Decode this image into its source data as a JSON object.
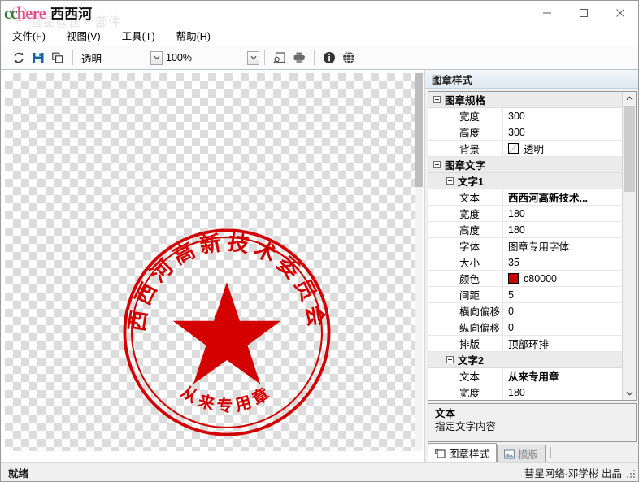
{
  "window": {
    "logo_cc": "cc",
    "logo_here": "here",
    "logo_cn": "西西河",
    "watermark": "彗星@国年部件",
    "minimize_label": "minimize",
    "maximize_label": "maximize",
    "close_label": "close"
  },
  "menubar": {
    "items": [
      {
        "label": "文件(F)"
      },
      {
        "label": "视图(V)"
      },
      {
        "label": "工具(T)"
      },
      {
        "label": "帮助(H)"
      }
    ]
  },
  "toolbar": {
    "refresh_label": "refresh",
    "save_label": "save",
    "copy_label": "copy",
    "background_combo": "透明",
    "zoom_combo": "100%",
    "preview_label": "preview",
    "print_label": "print",
    "info_label": "info",
    "web_label": "web"
  },
  "canvas": {
    "zoom": "100%",
    "background": "透明",
    "stamp": {
      "top_text": "西西河高新技术委员会",
      "bottom_text": "从来专用章",
      "color": "#d40000",
      "star": "★"
    }
  },
  "panel": {
    "header": "图章样式",
    "rows": [
      {
        "type": "cat",
        "indent": 0,
        "name": "图章规格",
        "value": "",
        "bold": false,
        "swatch": null
      },
      {
        "type": "prop",
        "indent": 2,
        "name": "宽度",
        "value": "300",
        "bold": false,
        "swatch": null
      },
      {
        "type": "prop",
        "indent": 2,
        "name": "高度",
        "value": "300",
        "bold": false,
        "swatch": null
      },
      {
        "type": "prop",
        "indent": 2,
        "name": "背景",
        "value": "透明",
        "bold": false,
        "swatch": "transparent"
      },
      {
        "type": "cat",
        "indent": 0,
        "name": "图章文字",
        "value": "",
        "bold": false,
        "swatch": null
      },
      {
        "type": "cat",
        "indent": 1,
        "name": "文字1",
        "value": "",
        "bold": false,
        "swatch": null
      },
      {
        "type": "prop",
        "indent": 2,
        "name": "文本",
        "value": "西西河高新技术...",
        "bold": true,
        "swatch": null
      },
      {
        "type": "prop",
        "indent": 2,
        "name": "宽度",
        "value": "180",
        "bold": false,
        "swatch": null
      },
      {
        "type": "prop",
        "indent": 2,
        "name": "高度",
        "value": "180",
        "bold": false,
        "swatch": null
      },
      {
        "type": "prop",
        "indent": 2,
        "name": "字体",
        "value": "图章专用字体",
        "bold": false,
        "swatch": null
      },
      {
        "type": "prop",
        "indent": 2,
        "name": "大小",
        "value": "35",
        "bold": false,
        "swatch": null
      },
      {
        "type": "prop",
        "indent": 2,
        "name": "颜色",
        "value": "c80000",
        "bold": false,
        "swatch": "#c80000"
      },
      {
        "type": "prop",
        "indent": 2,
        "name": "间距",
        "value": "5",
        "bold": false,
        "swatch": null
      },
      {
        "type": "prop",
        "indent": 2,
        "name": "横向偏移",
        "value": "0",
        "bold": false,
        "swatch": null
      },
      {
        "type": "prop",
        "indent": 2,
        "name": "纵向偏移",
        "value": "0",
        "bold": false,
        "swatch": null
      },
      {
        "type": "prop",
        "indent": 2,
        "name": "排版",
        "value": "顶部环排",
        "bold": false,
        "swatch": null
      },
      {
        "type": "cat",
        "indent": 1,
        "name": "文字2",
        "value": "",
        "bold": false,
        "swatch": null
      },
      {
        "type": "prop",
        "indent": 2,
        "name": "文本",
        "value": "从来专用章",
        "bold": true,
        "swatch": null
      },
      {
        "type": "prop",
        "indent": 2,
        "name": "宽度",
        "value": "180",
        "bold": false,
        "swatch": null
      }
    ],
    "description": {
      "title": "文本",
      "text": "指定文字内容"
    },
    "tabs": [
      {
        "label": "图章样式",
        "active": true,
        "icon": "stamp-icon"
      },
      {
        "label": "模版",
        "active": false,
        "icon": "image-icon"
      }
    ]
  },
  "statusbar": {
    "left": "就绪",
    "right": "彗星网络·邓学彬 出品"
  }
}
